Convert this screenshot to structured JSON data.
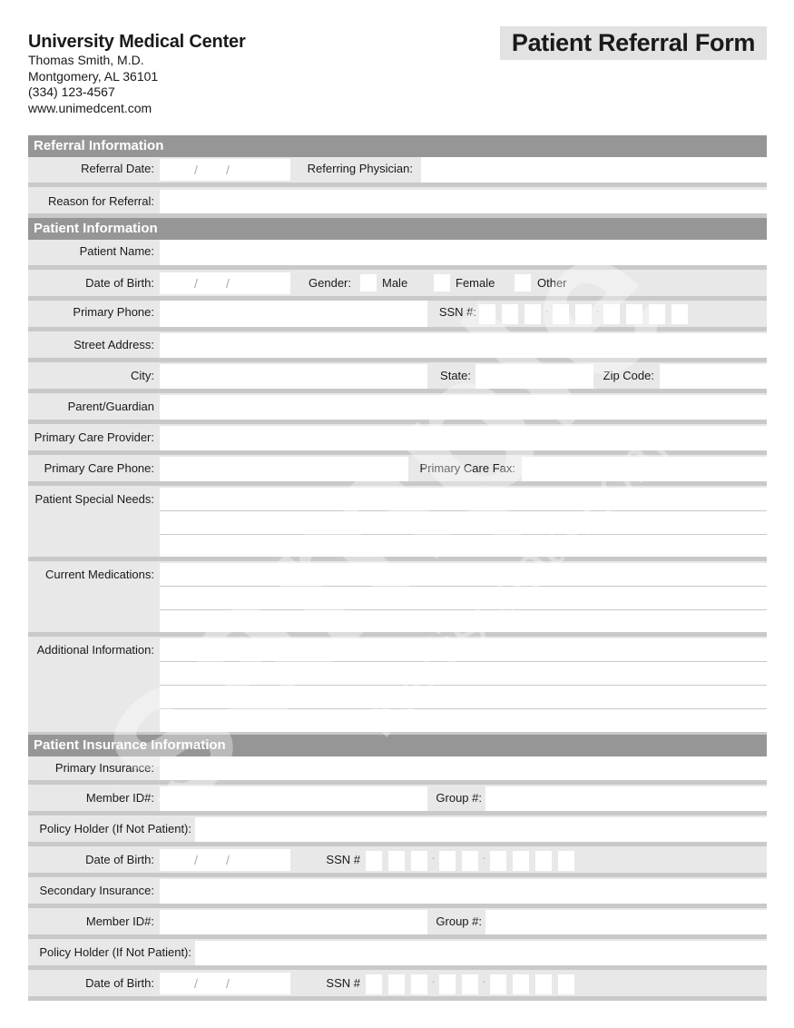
{
  "header": {
    "org_name": "University Medical Center",
    "physician": "Thomas Smith, M.D.",
    "address": "Montgomery, AL 36101",
    "phone": "(334) 123-4567",
    "website": "www.unimedcent.com",
    "form_title": "Patient Referral Form"
  },
  "referral": {
    "section_title": "Referral Information",
    "referral_date_label": "Referral Date:",
    "referring_physician_label": "Referring Physician:",
    "reason_label": "Reason for Referral:"
  },
  "patient": {
    "section_title": "Patient Information",
    "name_label": "Patient Name:",
    "dob_label": "Date of Birth:",
    "gender_label": "Gender:",
    "gender_options": [
      "Male",
      "Female",
      "Other"
    ],
    "primary_phone_label": "Primary Phone:",
    "ssn_label": "SSN #:",
    "street_label": "Street Address:",
    "city_label": "City:",
    "state_label": "State:",
    "zip_label": "Zip Code:",
    "guardian_label": "Parent/Guardian",
    "pcp_label": "Primary Care Provider:",
    "pcp_phone_label": "Primary Care Phone:",
    "pcp_fax_label": "Primary Care Fax:",
    "special_needs_label": "Patient Special Needs:",
    "medications_label": "Current Medications:",
    "additional_label": "Additional Information:"
  },
  "insurance": {
    "section_title": "Patient Insurance Information",
    "primary_label": "Primary Insurance:",
    "secondary_label": "Secondary Insurance:",
    "member_id_label": "Member ID#:",
    "group_label": "Group #:",
    "policy_holder_label": "Policy Holder (If Not Patient):",
    "dob_label": "Date of Birth:",
    "ssn_label": "SSN #"
  },
  "date_separator": "/",
  "ssn_separator": "-",
  "watermark": {
    "big_text": "sample",
    "small_text": "mediscripts.com"
  }
}
